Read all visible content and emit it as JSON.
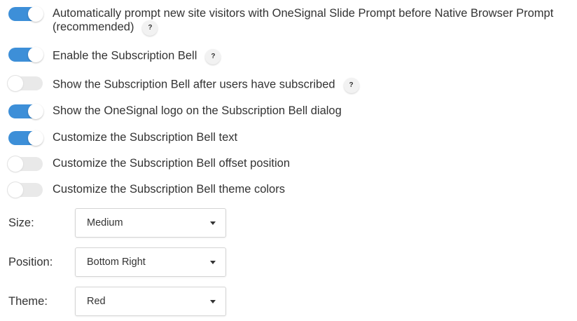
{
  "toggles": [
    {
      "line1": "Automatically prompt new site visitors with OneSignal Slide Prompt before Native Browser Prompt",
      "line2": "(recommended)",
      "on": true,
      "help": "?"
    },
    {
      "label": "Enable the Subscription Bell",
      "on": true,
      "help": "?"
    },
    {
      "label": "Show the Subscription Bell after users have subscribed",
      "on": false,
      "help": "?"
    },
    {
      "label": "Show the OneSignal logo on the Subscription Bell dialog",
      "on": true
    },
    {
      "label": "Customize the Subscription Bell text",
      "on": true
    },
    {
      "label": "Customize the Subscription Bell offset position",
      "on": false
    },
    {
      "label": "Customize the Subscription Bell theme colors",
      "on": false
    }
  ],
  "fields": {
    "size": {
      "label": "Size:",
      "value": "Medium"
    },
    "position": {
      "label": "Position:",
      "value": "Bottom Right"
    },
    "theme": {
      "label": "Theme:",
      "value": "Red"
    }
  },
  "colors": {
    "toggle_on": "#3d8fd8",
    "toggle_off": "#e9e9e9",
    "text": "#333333"
  }
}
